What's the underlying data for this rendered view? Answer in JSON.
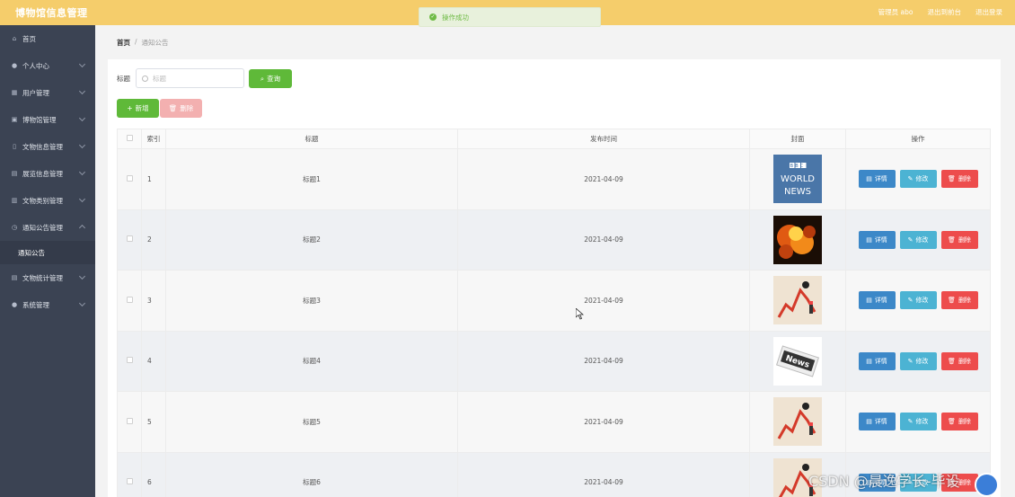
{
  "app": {
    "title": "博物馆信息管理"
  },
  "header": {
    "admin_label": "管理员 abo",
    "to_front_label": "退出到前台",
    "logout_label": "退出登录"
  },
  "toast": {
    "message": "操作成功"
  },
  "sidebar": {
    "items": [
      {
        "label": "首页",
        "icon": "home-icon"
      },
      {
        "label": "个人中心",
        "icon": "user-icon"
      },
      {
        "label": "用户管理",
        "icon": "users-icon"
      },
      {
        "label": "博物馆管理",
        "icon": "building-icon"
      },
      {
        "label": "文物信息管理",
        "icon": "artifact-icon"
      },
      {
        "label": "展览信息管理",
        "icon": "exhibit-icon"
      },
      {
        "label": "文物类别管理",
        "icon": "category-icon"
      },
      {
        "label": "通知公告管理",
        "icon": "notice-icon"
      },
      {
        "label": "文物统计管理",
        "icon": "stats-icon"
      },
      {
        "label": "系统管理",
        "icon": "system-icon"
      }
    ],
    "sub_active": "通知公告"
  },
  "breadcrumb": {
    "home": "首页",
    "separator": "/",
    "current": "通知公告"
  },
  "search": {
    "label": "标题",
    "placeholder": "标题",
    "query_label": "查询"
  },
  "toolbar": {
    "add_label": "新增",
    "delete_label": "删除"
  },
  "table": {
    "headers": {
      "index": "索引",
      "title": "标题",
      "date": "发布时间",
      "cover": "封面",
      "actions": "操作"
    },
    "action_labels": {
      "detail": "详情",
      "edit": "修改",
      "delete": "删除"
    },
    "rows": [
      {
        "index": "1",
        "title": "标题1",
        "date": "2021-04-09",
        "cover": "bbc"
      },
      {
        "index": "2",
        "title": "标题2",
        "date": "2021-04-09",
        "cover": "fire"
      },
      {
        "index": "3",
        "title": "标题3",
        "date": "2021-04-09",
        "cover": "chart"
      },
      {
        "index": "4",
        "title": "标题4",
        "date": "2021-04-09",
        "cover": "news"
      },
      {
        "index": "5",
        "title": "标题5",
        "date": "2021-04-09",
        "cover": "chart"
      },
      {
        "index": "6",
        "title": "标题6",
        "date": "2021-04-09",
        "cover": "chart"
      }
    ]
  },
  "bbc_cover": {
    "line1": "BBC",
    "line2": "WORLD",
    "line3": "NEWS"
  },
  "news_cover": {
    "text": "News"
  },
  "watermark": {
    "text": "CSDN @晨逸学长-毕设"
  },
  "colors": {
    "topbar": "#f5cd6b",
    "sidebar": "#3b4353",
    "success": "#5fb939",
    "danger": "#ed4c4c",
    "primary": "#3c88c8",
    "info": "#4cb3d3"
  }
}
